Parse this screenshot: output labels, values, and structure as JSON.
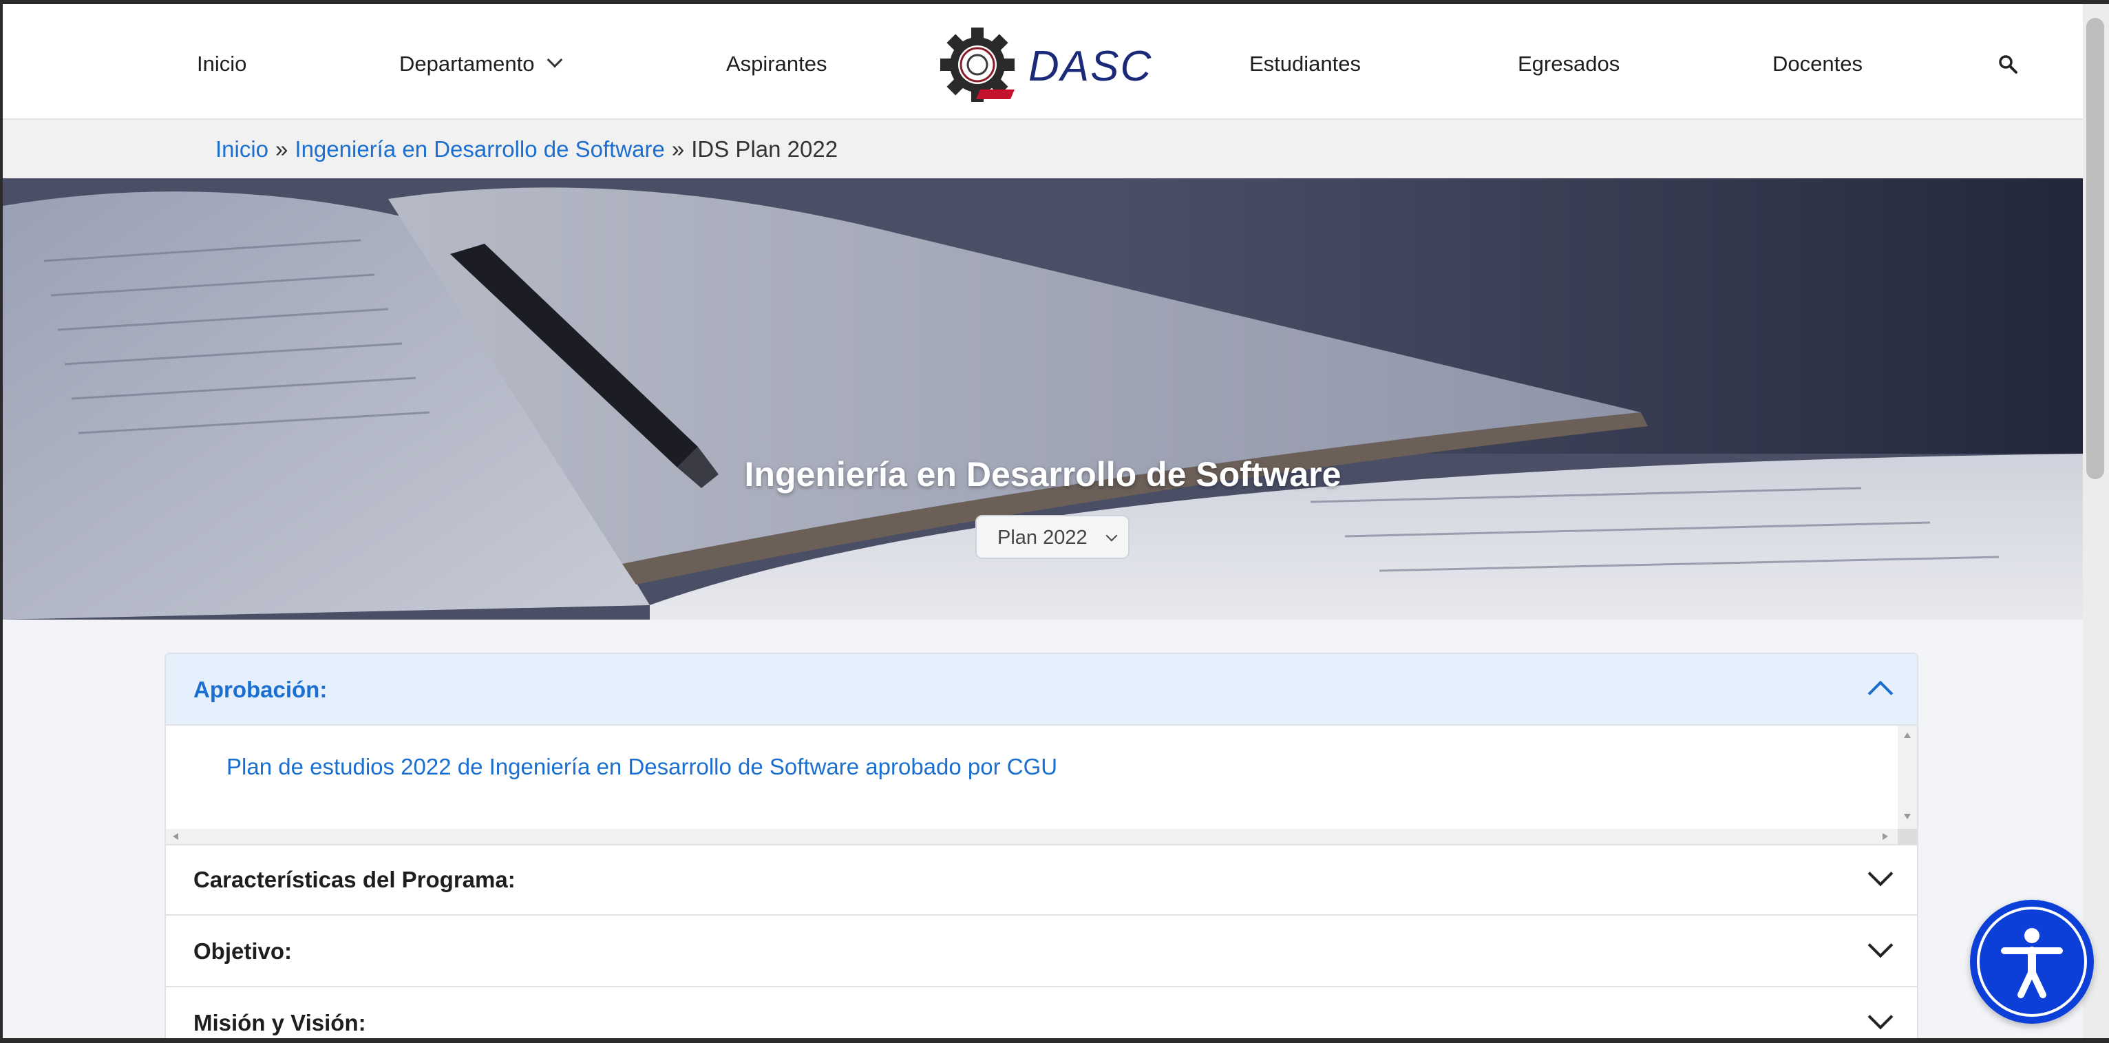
{
  "nav": {
    "items": [
      "Inicio",
      "Departamento",
      "Aspirantes",
      "Estudiantes",
      "Egresados",
      "Docentes"
    ],
    "logo_text": "DASC"
  },
  "breadcrumb": {
    "home": "Inicio",
    "sep1": "»",
    "parent": "Ingeniería en Desarrollo de Software",
    "sep2": "»",
    "current": "IDS Plan 2022"
  },
  "hero": {
    "title": "Ingeniería en Desarrollo de Software",
    "plan_selected": "Plan 2022"
  },
  "accordion": {
    "sections": [
      {
        "title": "Aprobación:",
        "expanded": true
      },
      {
        "title": "Características del Programa:",
        "expanded": false
      },
      {
        "title": "Objetivo:",
        "expanded": false
      },
      {
        "title": "Misión y Visión:",
        "expanded": false
      }
    ],
    "approval_link": "Plan de estudios 2022 de Ingeniería en Desarrollo de Software aprobado por CGU"
  },
  "colors": {
    "link": "#1a6fd0",
    "accent_bg": "#e6f0fd",
    "a11y_button": "#0b3fd8",
    "logo_text": "#1b2a78"
  },
  "icons": [
    "chevron-down-icon",
    "search-icon",
    "chevron-up-icon",
    "accessibility-icon",
    "gear-logo-icon"
  ]
}
